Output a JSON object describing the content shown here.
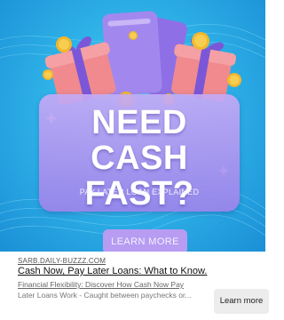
{
  "ad": {
    "headline_line1": "NEED CASH",
    "headline_line2": "FAST?",
    "subline": "PAY LATER LOAN EXPLAINED",
    "cta_label": "LEARN MORE",
    "colors": {
      "background": "#2fb3e8",
      "card": "#b49bf0",
      "cta": "#b79cf2",
      "gift_box": "#f08a8e",
      "ribbon": "#7b57d8",
      "coin": "#f2b72d"
    }
  },
  "listing": {
    "domain": "SARB.DAILY-BUZZZ.COM",
    "title": "Cash Now, Pay Later Loans: What to Know.",
    "description_line1": "Financial Flexibility: Discover How Cash Now Pay",
    "description_line2": "Later Loans Work - Caught between paychecks or...",
    "button_label": "Learn more"
  }
}
